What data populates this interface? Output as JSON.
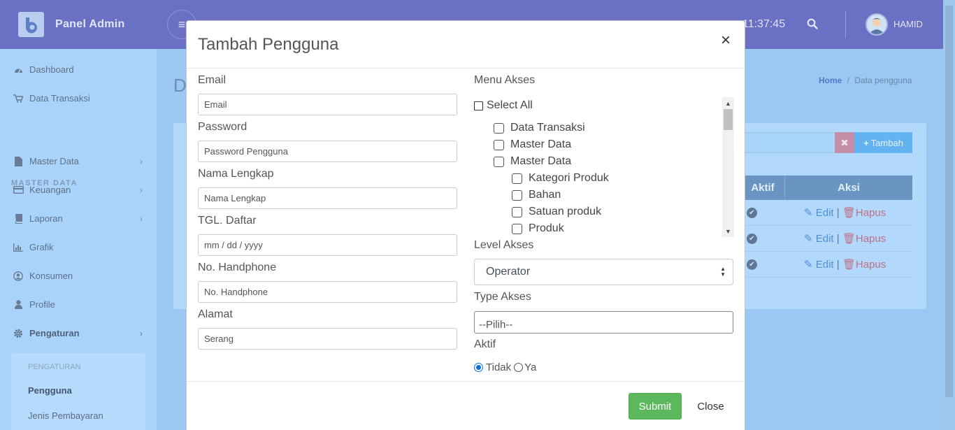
{
  "header": {
    "brand": "Panel Admin",
    "clock": "11:37:45",
    "username": "HAMID"
  },
  "sidebar": {
    "items": [
      {
        "label": "Dashboard",
        "icon": "dashboard-icon"
      },
      {
        "label": "Data Transaksi",
        "icon": "cart-icon"
      },
      {
        "label": "Master Data",
        "icon": "file-icon"
      },
      {
        "label": "Keuangan",
        "icon": "credit-card-icon"
      },
      {
        "label": "Laporan",
        "icon": "book-icon"
      },
      {
        "label": "Grafik",
        "icon": "bar-chart-icon"
      },
      {
        "label": "Konsumen",
        "icon": "user-circle-icon"
      },
      {
        "label": "Profile",
        "icon": "user-icon"
      },
      {
        "label": "Pengaturan",
        "icon": "gear-icon"
      }
    ],
    "section_heading": "MASTER DATA",
    "submenu": {
      "heading": "PENGATURAN",
      "items": [
        "Pengguna",
        "Jenis Pembayaran"
      ]
    }
  },
  "page": {
    "title_initial": "D",
    "breadcrumb_home": "Home",
    "breadcrumb_sep": "/",
    "breadcrumb_current": "Data pengguna",
    "add_button": "Tambah",
    "table_headers": [
      "Aktif",
      "Aksi"
    ],
    "row_actions": {
      "edit": "Edit",
      "separator": "|",
      "delete": "Hapus"
    }
  },
  "modal": {
    "title": "Tambah Pengguna",
    "close_glyph": "×",
    "fields": {
      "email": {
        "label": "Email",
        "placeholder": "Email",
        "value": ""
      },
      "password": {
        "label": "Password",
        "placeholder": "Password Pengguna",
        "value": ""
      },
      "fullname": {
        "label": "Nama Lengkap",
        "placeholder": "Nama Lengkap",
        "value": ""
      },
      "date": {
        "label": "TGL. Daftar",
        "placeholder": "mm / dd / yyyy",
        "value": ""
      },
      "phone": {
        "label": "No. Handphone",
        "placeholder": "No. Handphone",
        "value": ""
      },
      "address": {
        "label": "Alamat",
        "placeholder": "",
        "value": "Serang"
      }
    },
    "menu_akses": {
      "label": "Menu Akses",
      "select_all": "Select All",
      "items": [
        {
          "label": "Data Transaksi",
          "level": 1
        },
        {
          "label": "Master Data",
          "level": 1
        },
        {
          "label": "Master Data",
          "level": 1
        },
        {
          "label": "Kategori Produk",
          "level": 2
        },
        {
          "label": "Bahan",
          "level": 2
        },
        {
          "label": "Satuan produk",
          "level": 2
        },
        {
          "label": "Produk",
          "level": 2
        }
      ]
    },
    "level_akses": {
      "label": "Level Akses",
      "selected": "Operator"
    },
    "type_akses": {
      "label": "Type Akses",
      "placeholder": "--Pilih--"
    },
    "aktif": {
      "label": "Aktif",
      "options": [
        "Tidak",
        "Ya"
      ],
      "selected": "Tidak"
    },
    "buttons": {
      "submit": "Submit",
      "close": "Close"
    }
  },
  "colors": {
    "topbar": "#6a71c4",
    "sidebar": "#a9d3fa",
    "submit": "#5cb85c",
    "radio_accent": "#0b6fd8"
  }
}
